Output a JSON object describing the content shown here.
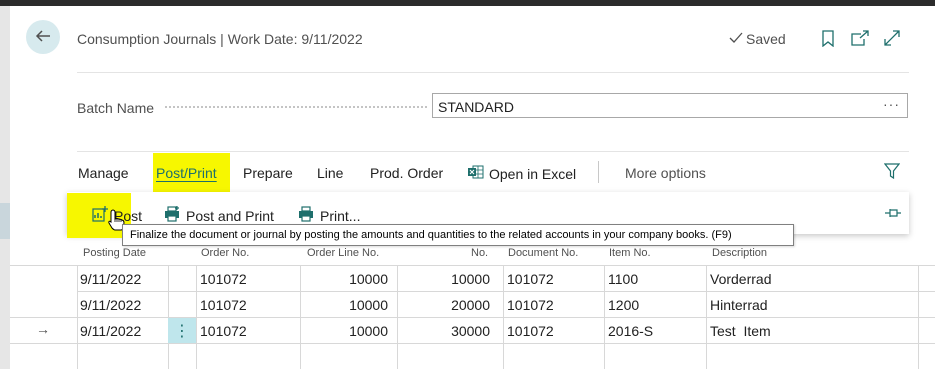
{
  "header": {
    "title": "Consumption Journals | Work Date: 9/11/2022",
    "saved_label": "Saved"
  },
  "batch": {
    "label": "Batch Name",
    "value": "STANDARD",
    "lookup_glyph": "···"
  },
  "actions": {
    "manage": "Manage",
    "post_print": "Post/Print",
    "prepare": "Prepare",
    "line": "Line",
    "prod_order": "Prod. Order",
    "open_in_excel": "Open in Excel",
    "more_options": "More options"
  },
  "submenu": {
    "post": "Post",
    "post_and_print": "Post and Print",
    "print": "Print..."
  },
  "tooltip": "Finalize the document or journal by posting the amounts and quantities to the related accounts in your company books. (F9)",
  "table": {
    "columns": {
      "posting_date": "Posting Date",
      "order_no": "Order No.",
      "order_line_no": "Order Line No.",
      "line_no": "No.",
      "document_no": "Document No.",
      "item_no": "Item No.",
      "description": "Description"
    },
    "rows": [
      {
        "posting_date": "9/11/2022",
        "order_no": "101072",
        "order_line_no": "10000",
        "line_no": "10000",
        "document_no": "101072",
        "item_no": "1100",
        "description": "Vorderrad"
      },
      {
        "posting_date": "9/11/2022",
        "order_no": "101072",
        "order_line_no": "10000",
        "line_no": "20000",
        "document_no": "101072",
        "item_no": "1200",
        "description": "Hinterrad"
      },
      {
        "posting_date": "9/11/2022",
        "order_no": "101072",
        "order_line_no": "10000",
        "line_no": "30000",
        "document_no": "101072",
        "item_no": "2016-S",
        "description": "Test  Item"
      }
    ],
    "row_menu_glyph": "⋮",
    "current_row_glyph": "→"
  },
  "colors": {
    "accent": "#1e6f6c",
    "highlight": "#f7f700",
    "back_button_bg": "#d7eaee"
  },
  "icons": {
    "back": "arrow-left-icon",
    "saved": "checkmark-icon",
    "bookmark": "bookmark-icon",
    "open_new": "open-in-new-window-icon",
    "expand": "expand-icon",
    "excel": "excel-icon",
    "filter": "filter-icon",
    "post": "post-icon",
    "post_print": "post-and-print-icon",
    "print": "printer-icon",
    "pin": "pin-icon",
    "cursor": "hand-cursor-icon"
  }
}
